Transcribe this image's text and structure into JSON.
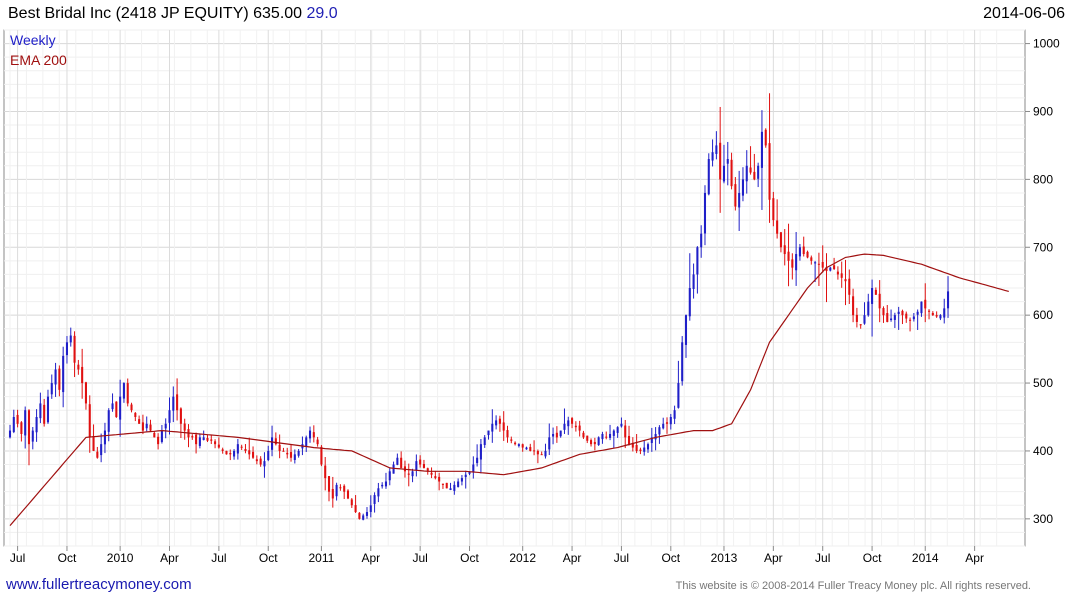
{
  "header": {
    "title": "Best Bridal Inc (2418 JP EQUITY) 635.00",
    "change": "29.0",
    "date": "2014-06-06"
  },
  "footer": {
    "site": "www.fullertreacymoney.com",
    "copyright": "This website is © 2008-2014 Fuller Treacy Money plc. All rights reserved."
  },
  "colors": {
    "up": "#1f1fc8",
    "down": "#e01010",
    "ema": "#a01010",
    "grid": "#e4e4e4"
  },
  "chart_data": {
    "type": "candlestick",
    "legend": [
      "Weekly",
      "EMA 200"
    ],
    "legend_position": "top-left",
    "grid": true,
    "ylim": [
      260,
      1020
    ],
    "y_ticks": [
      300,
      400,
      500,
      600,
      700,
      800,
      900,
      1000
    ],
    "x_ticks": [
      "Jul",
      "Oct",
      "2010",
      "Apr",
      "Jul",
      "Oct",
      "2011",
      "Apr",
      "Jul",
      "Oct",
      "2012",
      "Apr",
      "Jul",
      "Oct",
      "2013",
      "Apr",
      "Jul",
      "Oct",
      "2014",
      "Apr"
    ],
    "x_tick_weeks": [
      2,
      15,
      29,
      42,
      55,
      68,
      82,
      95,
      108,
      121,
      135,
      148,
      161,
      174,
      188,
      201,
      214,
      227,
      241,
      254
    ],
    "weeks_total": 263,
    "closes": [
      430,
      450,
      440,
      425,
      460,
      410,
      430,
      450,
      470,
      440,
      480,
      500,
      520,
      490,
      540,
      560,
      570,
      530,
      520,
      500,
      470,
      420,
      400,
      390,
      410,
      430,
      460,
      470,
      450,
      480,
      500,
      470,
      460,
      450,
      440,
      430,
      440,
      430,
      420,
      410,
      430,
      440,
      460,
      480,
      460,
      440,
      430,
      420,
      420,
      410,
      420,
      420,
      415,
      415,
      410,
      405,
      400,
      395,
      395,
      400,
      410,
      405,
      400,
      395,
      390,
      385,
      380,
      385,
      400,
      420,
      410,
      400,
      400,
      395,
      390,
      395,
      400,
      410,
      420,
      430,
      420,
      410,
      380,
      360,
      340,
      330,
      350,
      345,
      340,
      330,
      320,
      310,
      300,
      305,
      310,
      320,
      335,
      345,
      350,
      355,
      370,
      380,
      390,
      375,
      370,
      365,
      370,
      385,
      380,
      375,
      370,
      365,
      360,
      355,
      350,
      345,
      345,
      350,
      355,
      360,
      365,
      370,
      380,
      390,
      410,
      420,
      430,
      440,
      445,
      440,
      430,
      420,
      415,
      410,
      410,
      405,
      405,
      400,
      400,
      395,
      395,
      400,
      420,
      425,
      420,
      430,
      440,
      445,
      440,
      435,
      430,
      420,
      415,
      410,
      410,
      420,
      425,
      420,
      425,
      430,
      435,
      440,
      420,
      410,
      405,
      400,
      400,
      405,
      410,
      420,
      425,
      435,
      440,
      440,
      450,
      460,
      500,
      560,
      600,
      640,
      660,
      700,
      720,
      780,
      830,
      840,
      850,
      800,
      820,
      830,
      790,
      760,
      780,
      800,
      820,
      810,
      800,
      820,
      870,
      850,
      770,
      740,
      720,
      700,
      690,
      680,
      670,
      690,
      700,
      690,
      685,
      680,
      678,
      675,
      670,
      665,
      670,
      668,
      660,
      655,
      650,
      630,
      600,
      590,
      585,
      600,
      620,
      640,
      630,
      610,
      600,
      590,
      595,
      600,
      605,
      600,
      595,
      592,
      598,
      605,
      620,
      610,
      605,
      600,
      598,
      600,
      610,
      635
    ],
    "ema_anchor_weeks": [
      0,
      20,
      40,
      60,
      80,
      90,
      100,
      110,
      120,
      130,
      140,
      150,
      160,
      170,
      180,
      185,
      190,
      195,
      200,
      205,
      210,
      215,
      220,
      225,
      230,
      240,
      250,
      263
    ],
    "ema_anchor_values": [
      290,
      420,
      430,
      420,
      405,
      400,
      375,
      370,
      370,
      365,
      375,
      395,
      405,
      420,
      430,
      430,
      440,
      490,
      560,
      600,
      640,
      670,
      685,
      690,
      688,
      675,
      655,
      635
    ]
  }
}
